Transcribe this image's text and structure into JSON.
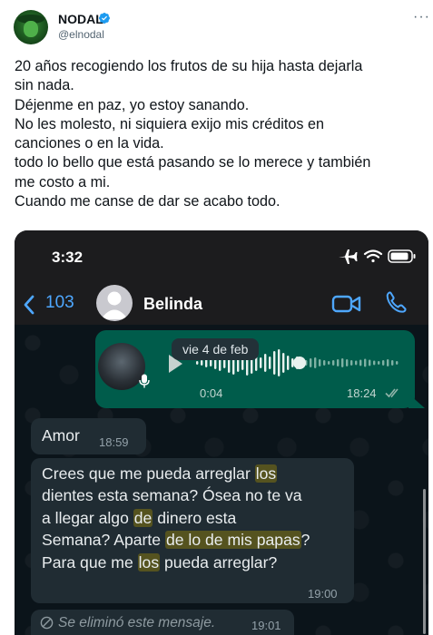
{
  "tweet": {
    "author_name": "NODAL",
    "author_handle": "@elnodal",
    "verified": true,
    "more_icon": "more-horizontal-icon",
    "text_lines": [
      "20 años recogiendo los frutos de su hija hasta dejarla",
      "sin nada.",
      "Déjenme en paz, yo estoy sanando.",
      "No les molesto, ni siquiera exijo mis créditos en",
      "canciones o en la vida.",
      "todo lo bello que está pasando se lo merece y también",
      "me costo a mi.",
      "Cuando me canse de dar se acabo todo."
    ]
  },
  "screenshot": {
    "status_time": "3:32",
    "back_count": "103",
    "contact_name": "Belinda",
    "voice_note": {
      "date_pill": "vie 4 de feb",
      "duration": "0:04",
      "time": "18:24"
    },
    "messages": [
      {
        "text": "Amor",
        "time": "18:59"
      },
      {
        "lines": [
          {
            "segments": [
              "Crees que me pueda arreglar ",
              "los"
            ]
          },
          {
            "segments": [
              "dientes esta semana? Ósea no te va"
            ]
          },
          {
            "segments": [
              "a llegar algo ",
              "de",
              " dinero esta"
            ]
          },
          {
            "segments": [
              "Semana? Aparte ",
              "de lo de mis papas",
              "?"
            ]
          },
          {
            "segments": [
              "Para que me ",
              "los",
              " pueda arreglar?"
            ]
          }
        ],
        "time": "19:00"
      },
      {
        "text": "Se eliminó este mensaje.",
        "time": "19:01"
      }
    ],
    "colors": {
      "header_bg": "#1c1c1e",
      "chat_bg": "#0b141a",
      "outgoing_bubble": "#005c4b",
      "incoming_bubble": "#202c33",
      "accent_blue": "#4ea7ff",
      "highlight": "#55531f"
    }
  }
}
